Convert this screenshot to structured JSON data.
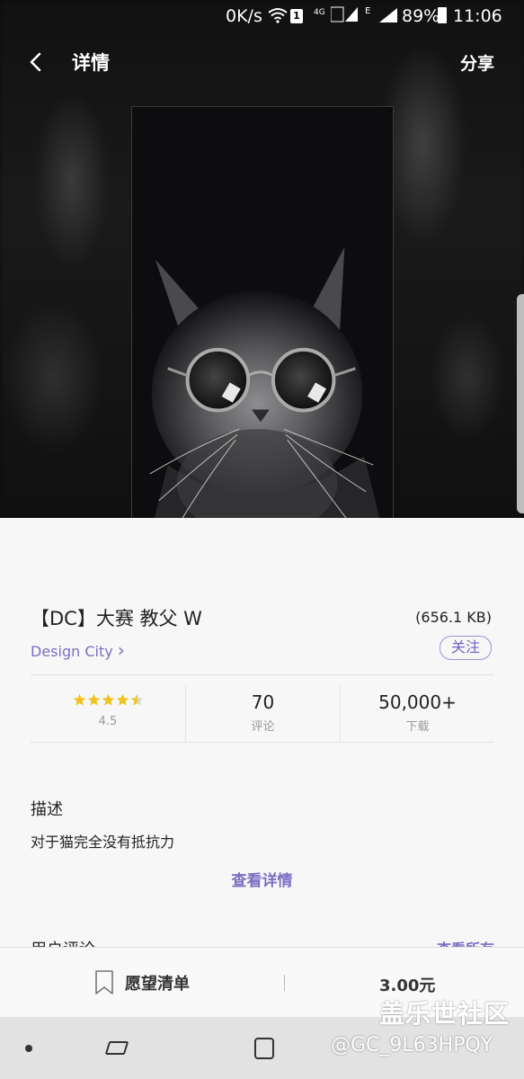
{
  "status_bar": {
    "net_speed": "0K/s",
    "sim_badge": "1",
    "network_4g": "4G",
    "network_e": "E",
    "battery": "89%",
    "time": "11:06",
    "icons": [
      "wifi-icon",
      "signal-icon",
      "battery-icon"
    ]
  },
  "app_bar": {
    "back_icon": "chevron-left-icon",
    "title": "详情",
    "share_label": "分享"
  },
  "preview": {
    "image": "cat-with-round-sunglasses"
  },
  "item": {
    "title": "【DC】大赛 教父 W",
    "size": "(656.1 KB)",
    "author": "Design City",
    "author_chevron": "›",
    "follow_label": "关注"
  },
  "stats": {
    "rating_value": "4.5",
    "rating_stars": 4.5,
    "reviews_count": "70",
    "reviews_label": "评论",
    "downloads_count": "50,000+",
    "downloads_label": "下载"
  },
  "description": {
    "heading": "描述",
    "text": "对于猫完全没有抵抗力",
    "more_label": "查看详情"
  },
  "reviews": {
    "heading": "用户评论",
    "see_all_label": "查看所有"
  },
  "action_bar": {
    "wishlist_label": "愿望清单",
    "price": "3.00元"
  },
  "watermark": {
    "line1": "盖乐世社区",
    "line2": "@GC_9L63HPQY"
  },
  "colors": {
    "accent": "#7a6fc4",
    "star": "#f2c31c",
    "hero_bg": "#0b0b0c"
  }
}
